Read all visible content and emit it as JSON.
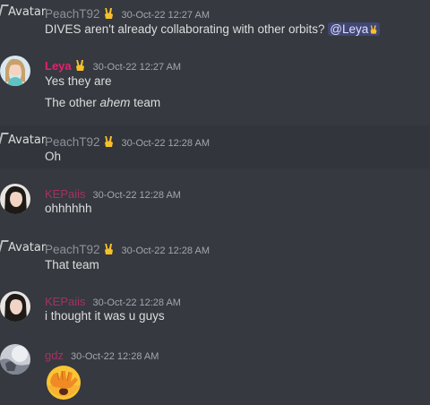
{
  "avatar_alt": "Avatar",
  "messages": [
    {
      "author": "PeachT92",
      "timestamp": "30-Oct-22 12:27 AM",
      "lines": [
        "DIVES aren't already collaborating with other orbits?"
      ],
      "mention": "@Leya"
    },
    {
      "author": "Leya",
      "timestamp": "30-Oct-22 12:27 AM",
      "lines": [
        "Yes they are"
      ],
      "line2_before": "The other ",
      "line2_em": "ahem",
      "line2_after": " team"
    },
    {
      "author": "PeachT92",
      "timestamp": "30-Oct-22 12:28 AM",
      "lines": [
        "Oh"
      ]
    },
    {
      "author": "KEPaiis",
      "timestamp": "30-Oct-22 12:28 AM",
      "lines": [
        "ohhhhhh"
      ]
    },
    {
      "author": "PeachT92",
      "timestamp": "30-Oct-22 12:28 AM",
      "lines": [
        "That team"
      ]
    },
    {
      "author": "KEPaiis",
      "timestamp": "30-Oct-22 12:28 AM",
      "lines": [
        "i thought it was u guys"
      ]
    },
    {
      "author": "gdz",
      "timestamp": "30-Oct-22 12:28 AM",
      "emoji": "face-with-hand-over-eyes-emoji"
    }
  ],
  "colors": {
    "background": "#36393f",
    "peach_name": "#8e9297",
    "leya_name": "#e2226f",
    "kep_name": "#c0316a",
    "mention_bg": "#414675"
  },
  "icons": {
    "badge": "victory-hand-icon",
    "broken_avatar": "broken-image-icon"
  }
}
